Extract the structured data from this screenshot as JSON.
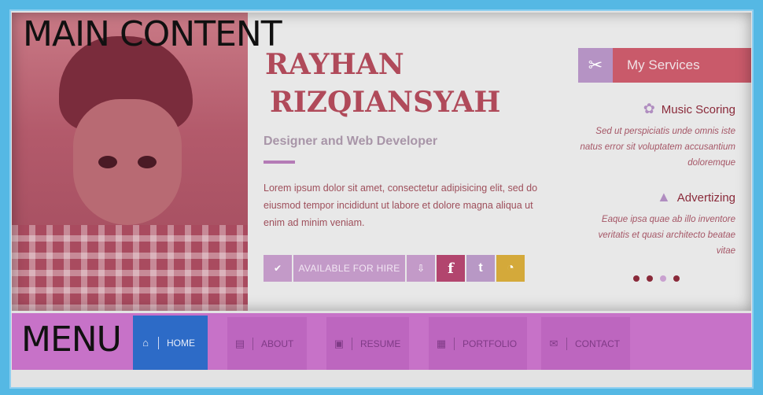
{
  "main_label": "MAIN CONTENT",
  "menu_label": "MENU",
  "profile": {
    "first_name": "RAYHAN",
    "last_name": "RIZQIANSYAH",
    "role": "Designer and Web Developer",
    "description": "Lorem ipsum dolor sit amet, consectetur adipisicing elit, sed do eiusmod tempor incididunt ut labore et dolore magna aliqua ut enim ad minim veniam."
  },
  "actions": {
    "check_icon": "✔",
    "hire_label": "AVAILABLE FOR HIRE",
    "download_icon": "⇩",
    "facebook_icon": "f",
    "twitter_icon": "t",
    "rss_icon": "◔"
  },
  "services": {
    "title": "My Services",
    "icon": "✂",
    "items": [
      {
        "icon": "✿",
        "title": "Music Scoring",
        "text": "Sed ut perspiciatis unde omnis iste natus error sit voluptatem accusantium doloremque"
      },
      {
        "icon": "▲",
        "title": "Advertizing",
        "text": "Eaque ipsa quae ab illo inventore veritatis et quasi architecto beatae vitae"
      }
    ],
    "slides": 4,
    "active_slide": 3
  },
  "nav": [
    {
      "icon": "⌂",
      "label": "HOME",
      "active": true
    },
    {
      "icon": "▤",
      "label": "ABOUT",
      "active": false
    },
    {
      "icon": "▣",
      "label": "RESUME",
      "active": false
    },
    {
      "icon": "▦",
      "label": "PORTFOLIO",
      "active": false
    },
    {
      "icon": "✉",
      "label": "CONTACT",
      "active": false
    }
  ],
  "colors": {
    "frame": "#55b8e4",
    "menu_bg": "#c772c8",
    "home_active": "#2d6bc7",
    "name": "#b04a5a"
  }
}
